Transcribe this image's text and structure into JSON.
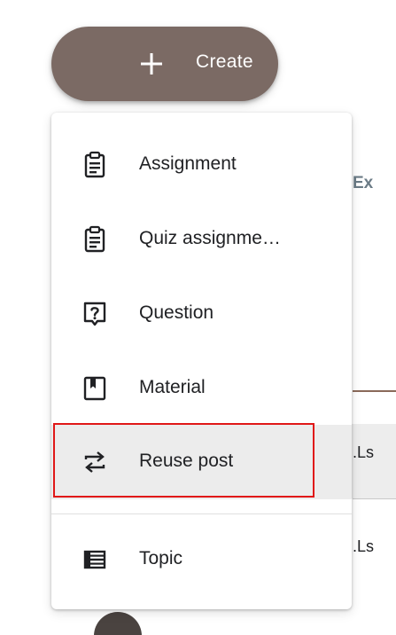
{
  "create_button": {
    "label": "Create",
    "icon": "plus-icon"
  },
  "menu": {
    "items": [
      {
        "label": "Assignment",
        "icon": "assignment-icon"
      },
      {
        "label": "Quiz assignme…",
        "icon": "quiz-assignment-icon"
      },
      {
        "label": "Question",
        "icon": "question-icon"
      },
      {
        "label": "Material",
        "icon": "material-icon"
      },
      {
        "label": "Reuse post",
        "icon": "reuse-post-icon",
        "selected": true
      },
      {
        "label": "Topic",
        "icon": "topic-icon"
      }
    ]
  },
  "background": {
    "header_fragment": "Ex",
    "row_fragments": [
      ".Ls",
      ".Ls"
    ]
  },
  "colors": {
    "fab": "#7b6a64",
    "selected_row": "#ececec",
    "highlight_outline": "#e01818"
  }
}
